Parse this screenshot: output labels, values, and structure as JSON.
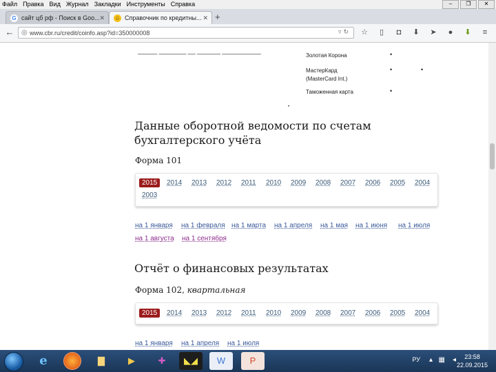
{
  "menu": [
    "Файл",
    "Правка",
    "Вид",
    "Журнал",
    "Закладки",
    "Инструменты",
    "Справка"
  ],
  "tabs": [
    {
      "label": "сайт цб рф - Поиск в Goo...",
      "favicon": "G"
    },
    {
      "label": "Справочник по кредитны...",
      "favicon": "☺"
    }
  ],
  "new_tab": "+",
  "url": "www.cbr.ru/credit/coinfo.asp?id=350000008",
  "cards": [
    {
      "name": "Золотая Корона"
    },
    {
      "name": "МастерКард",
      "name2": "(MasterCard Int.)"
    },
    {
      "name": "Таможенная карта"
    }
  ],
  "section1": {
    "title_line1": "Данные оборотной ведомости по счетам",
    "title_line2": "бухгалтерского учёта",
    "form_label": "Форма 101",
    "years": [
      "2015",
      "2014",
      "2013",
      "2012",
      "2011",
      "2010",
      "2009",
      "2008",
      "2007",
      "2006",
      "2005",
      "2004",
      "2003"
    ],
    "selected_year": "2015",
    "months": [
      "на 1 января",
      "на 1 февраля",
      "на 1 марта",
      "на 1 апреля",
      "на 1 мая",
      "на 1 июня",
      "на 1 июля",
      "на 1 августа",
      "на 1 сентября"
    ]
  },
  "section2": {
    "title": "Отчёт о финансовых результатах",
    "form_label": "Форма 102,",
    "form_sub": "квартальная",
    "years": [
      "2015",
      "2014",
      "2013",
      "2012",
      "2011",
      "2010",
      "2009",
      "2008",
      "2007",
      "2006",
      "2005",
      "2004"
    ],
    "quarters": [
      "на 1 января",
      "на 1 апреля",
      "на 1 июля"
    ]
  },
  "taskbar": {
    "lang": "РУ",
    "time": "23:58",
    "date": "22.09.2015"
  },
  "colors": {
    "selected_year_bg": "#9b1b1b",
    "link": "#3b5a9a",
    "visited": "#8b2d8b"
  }
}
